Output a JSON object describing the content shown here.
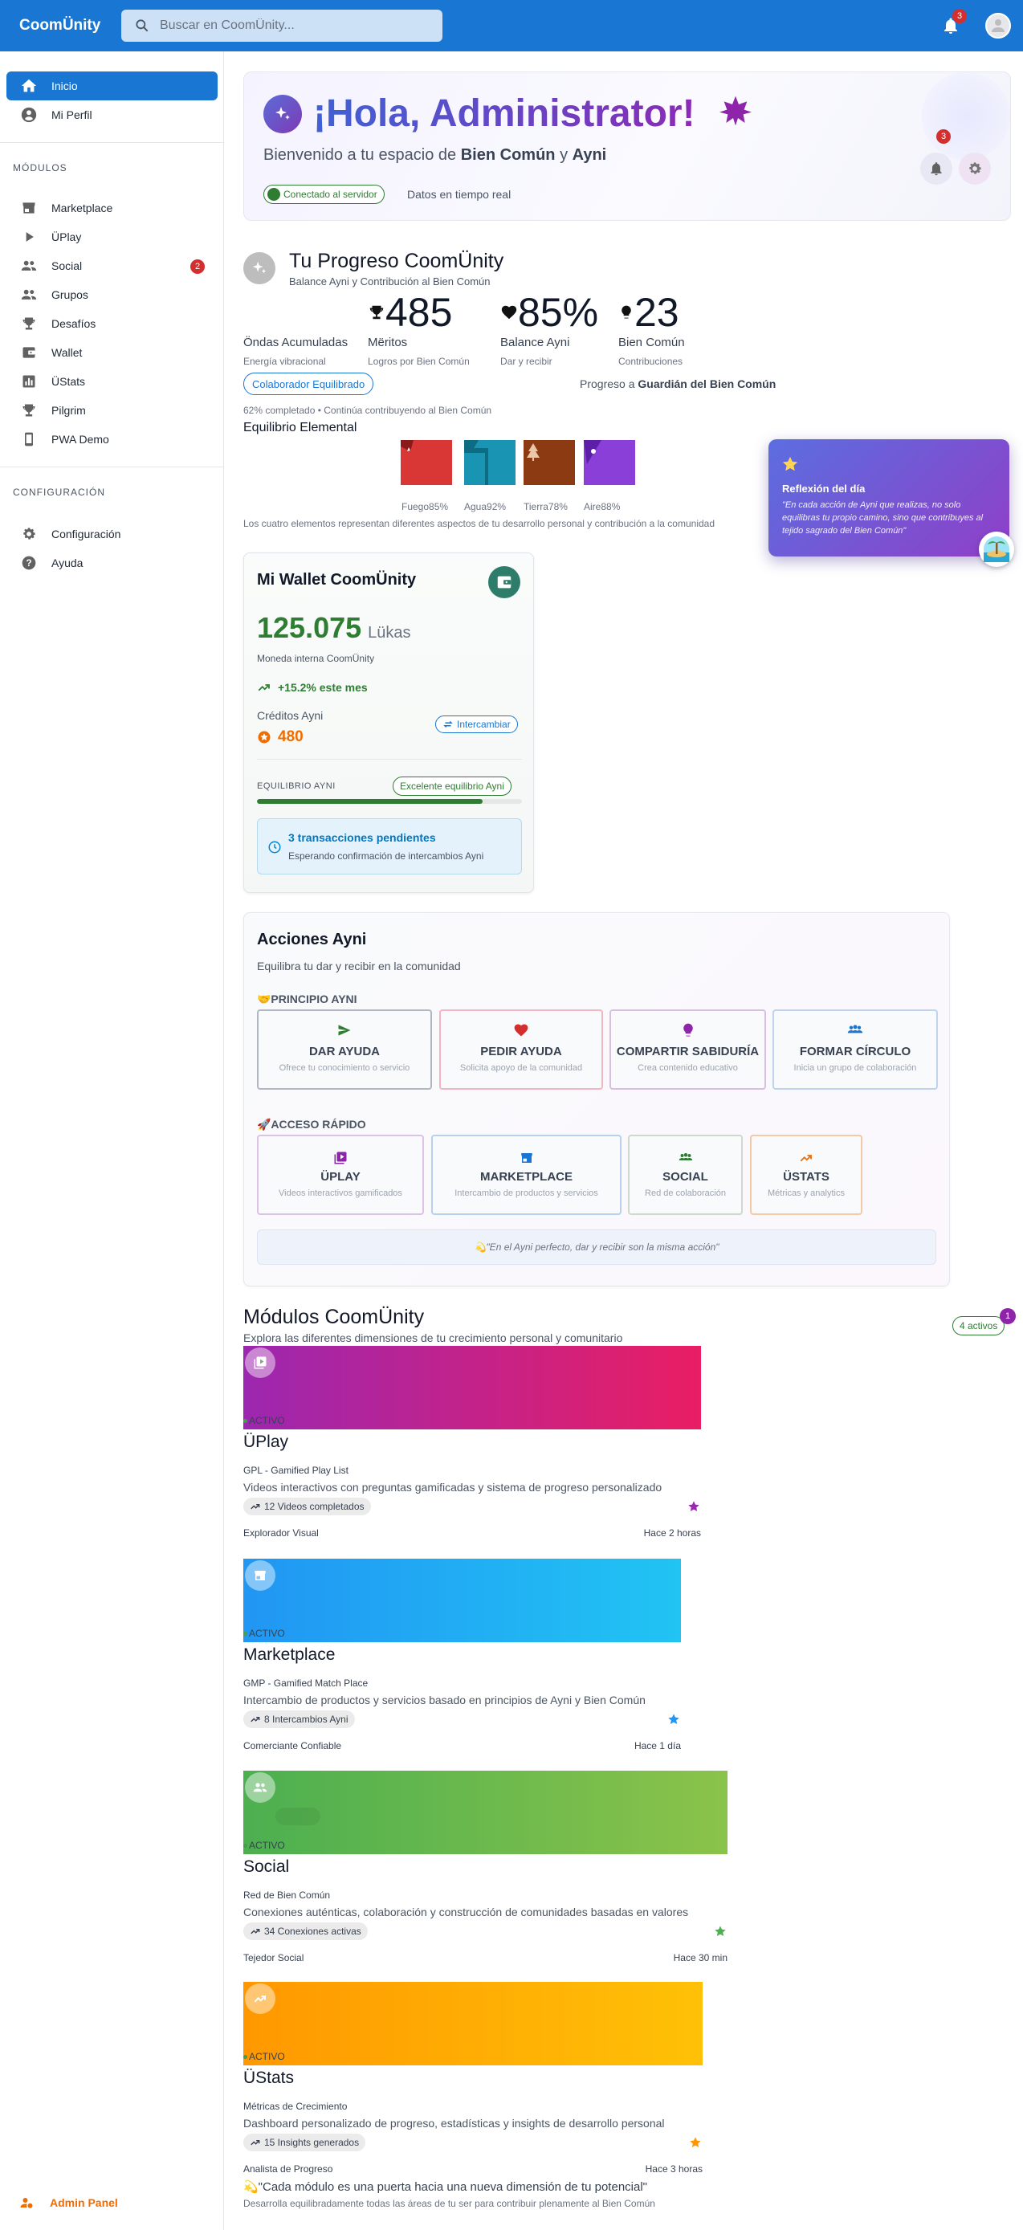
{
  "app": {
    "brand": "CoomÜnity"
  },
  "search": {
    "placeholder": "Buscar en CoomÜnity..."
  },
  "topbar": {
    "notifications_count": "3"
  },
  "sidebar": {
    "primary": [
      {
        "label": "Inicio",
        "icon": "home-icon",
        "active": true
      },
      {
        "label": "Mi Perfil",
        "icon": "account-icon"
      }
    ],
    "modules_label": "MÓDULOS",
    "modules": [
      {
        "label": "Marketplace",
        "icon": "store-icon"
      },
      {
        "label": "ÜPlay",
        "icon": "play-icon"
      },
      {
        "label": "Social",
        "icon": "people-icon",
        "badge": "2"
      },
      {
        "label": "Grupos",
        "icon": "groups-icon"
      },
      {
        "label": "Desafíos",
        "icon": "trophy-icon"
      },
      {
        "label": "Wallet",
        "icon": "wallet-icon"
      },
      {
        "label": "ÜStats",
        "icon": "stats-icon"
      },
      {
        "label": "Pilgrim",
        "icon": "trophy-icon"
      },
      {
        "label": "PWA Demo",
        "icon": "phone-icon"
      }
    ],
    "config_label": "CONFIGURACIÓN",
    "config": [
      {
        "label": "Configuración",
        "icon": "gear-icon"
      },
      {
        "label": "Ayuda",
        "icon": "help-icon"
      }
    ],
    "admin_label": "Admin Panel"
  },
  "hero": {
    "title": "¡Hola, Administrator!",
    "sub_prefix": "Bienvenido a tu espacio de ",
    "sub_b1": "Bien Común",
    "sub_mid": " y ",
    "sub_b2": "Ayni",
    "status_chip": "Conectado al servidor",
    "status_text": "Datos en tiempo real",
    "notif_count": "3"
  },
  "progress": {
    "title": "Tu Progreso CoomÜnity",
    "subtitle": "Balance Ayni y Contribución al Bien Común",
    "ondas_label": "Öndas Acumuladas",
    "ondas_sub": "Energía vibracional",
    "metrics": [
      {
        "value": "485",
        "label": "Mëritos",
        "sub": "Logros por Bien Común",
        "icon": "trophy-icon"
      },
      {
        "value": "85%",
        "label": "Balance Ayni",
        "sub": "Dar y recibir",
        "icon": "heart-icon"
      },
      {
        "value": "23",
        "label": "Bien Común",
        "sub": "Contribuciones",
        "icon": "bulb-icon"
      }
    ],
    "level_chip": "Colaborador Equilibrado",
    "next_prefix": "Progreso a ",
    "next_level": "Guardián del Bien Común",
    "pct_line": "62% completado • Continúa contribuyendo al Bien Común",
    "equilibrium_title": "Equilibrio Elemental",
    "elements": [
      {
        "name": "Fuego",
        "value": "85%",
        "color": "#d93636"
      },
      {
        "name": "Agua",
        "value": "92%",
        "color": "#1995b3"
      },
      {
        "name": "Tierra",
        "value": "78%",
        "color": "#8b3a12"
      },
      {
        "name": "Aire",
        "value": "88%",
        "color": "#8b3fd9"
      }
    ],
    "elements_note": "Los cuatro elementos representan diferentes aspectos de tu desarrollo personal y contribución a la comunidad"
  },
  "reflection": {
    "title": "Reflexión del día",
    "text": "\"En cada acción de Ayni que realizas, no solo equilibras tu propio camino, sino que contribuyes al tejido sagrado del Bien Común\""
  },
  "wallet": {
    "title": "Mi Wallet CoomÜnity",
    "amount": "125.075",
    "unit": "Lükas",
    "currency_note": "Moneda interna CoomÜnity",
    "trend": "+15.2% este mes",
    "credits_label": "Créditos Ayni",
    "credits_value": "480",
    "exchange_label": "Intercambiar",
    "equilibrium_label": "EQUILIBRIO AYNI",
    "equilibrium_chip": "Excelente equilibrio Ayni",
    "equilibrium_fill": 0.85,
    "pending_title": "3 transacciones pendientes",
    "pending_sub": "Esperando confirmación de intercambios Ayni"
  },
  "acciones": {
    "title": "Acciones Ayni",
    "subtitle": "Equilibra tu dar y recibir en la comunidad",
    "principle_label": "🤝PRINCIPIO AYNI",
    "principle": [
      {
        "title": "DAR AYUDA",
        "sub": "Ofrece tu conocimiento o servicio",
        "color": "#2e7d32",
        "icon": "send-icon"
      },
      {
        "title": "PEDIR AYUDA",
        "sub": "Solicita apoyo de la comunidad",
        "color": "#d32f2f",
        "icon": "heart-icon"
      },
      {
        "title": "COMPARTIR SABIDURÍA",
        "sub": "Crea contenido educativo",
        "color": "#8e24aa",
        "icon": "bulb-icon"
      },
      {
        "title": "FORMAR CÍRCULO",
        "sub": "Inicia un grupo de colaboración",
        "color": "#1976d2",
        "icon": "groups-icon"
      }
    ],
    "quick_label": "🚀ACCESO RÁPIDO",
    "quick": [
      {
        "title": "ÜPLAY",
        "sub": "Videos interactivos gamificados",
        "color": "#8e24aa",
        "icon": "video-library-icon"
      },
      {
        "title": "MARKETPLACE",
        "sub": "Intercambio de productos y servicios",
        "color": "#1976d2",
        "icon": "store-icon"
      },
      {
        "title": "SOCIAL",
        "sub": "Red de colaboración",
        "color": "#2e7d32",
        "icon": "groups-icon"
      },
      {
        "title": "ÜSTATS",
        "sub": "Métricas y analytics",
        "color": "#ef6c00",
        "icon": "trend-icon"
      }
    ],
    "quote": "💫\"En el Ayni perfecto, dar y recibir son la misma acción\""
  },
  "modules_section": {
    "title": "Módulos CoomÜnity",
    "subtitle": "Explora las diferentes dimensiones de tu crecimiento personal y comunitario",
    "active_chip": "4 activos",
    "badge": "1",
    "active_label": "ACTIVO",
    "items": [
      {
        "name": "ÜPlay",
        "code": "GPL - Gamified Play List",
        "desc": "Videos interactivos con preguntas gamificadas y sistema de progreso personalizado",
        "stat": "12 Videos completados",
        "level": "Explorador Visual",
        "time": "Hace 2 horas",
        "gradient_from": "#9c27b0",
        "gradient_to": "#e91e63",
        "star_color": "#9c27b0",
        "icon": "video-library-icon"
      },
      {
        "name": "Marketplace",
        "code": "GMP - Gamified Match Place",
        "desc": "Intercambio de productos y servicios basado en principios de Ayni y Bien Común",
        "stat": "8 Intercambios Ayni",
        "level": "Comerciante Confiable",
        "time": "Hace 1 día",
        "gradient_from": "#2196f3",
        "gradient_to": "#21c4f3",
        "star_color": "#2196f3",
        "icon": "store-icon"
      },
      {
        "name": "Social",
        "code": "Red de Bien Común",
        "desc": "Conexiones auténticas, colaboración y construcción de comunidades basadas en valores",
        "stat": "34 Conexiones activas",
        "level": "Tejedor Social",
        "time": "Hace 30 min",
        "gradient_from": "#4caf50",
        "gradient_to": "#8bc34a",
        "star_color": "#4caf50",
        "icon": "people-icon"
      },
      {
        "name": "ÜStats",
        "code": "Métricas de Crecimiento",
        "desc": "Dashboard personalizado de progreso, estadísticas y insights de desarrollo personal",
        "stat": "15 Insights generados",
        "level": "Analista de Progreso",
        "time": "Hace 3 horas",
        "gradient_from": "#ff9800",
        "gradient_to": "#ffc107",
        "star_color": "#ff9800",
        "icon": "trend-icon"
      }
    ],
    "footer_quote": "💫\"Cada módulo es una puerta hacia una nueva dimensión de tu potencial\"",
    "footer_sub": "Desarrolla equilibradamente todas las áreas de tu ser para contribuir plenamente al Bien Común"
  }
}
